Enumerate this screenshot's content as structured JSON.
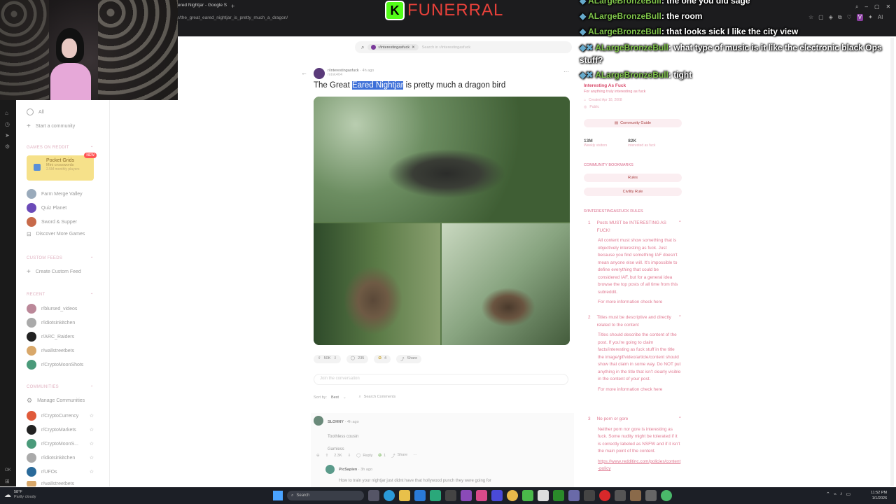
{
  "browser": {
    "tab_title": "ered Nightjar - Google S",
    "url": "r/the_great_eared_nightjar_is_pretty_much_a_dragon/"
  },
  "overlay": {
    "logo_letter": "K",
    "logo_text": "FUNERRAL",
    "chat": [
      {
        "user": "ALargeBronzeBull",
        "text": ": the one you did sage"
      },
      {
        "user": "ALargeBronzeBull",
        "text": ": the room"
      },
      {
        "user": "ALargeBronzeBull",
        "text": ": that looks sick I like the city view"
      },
      {
        "user": "ALargeBronzeBull",
        "text": ": what type of music is it like the electronic black Ops"
      },
      {
        "user": "",
        "text": "stuff?"
      },
      {
        "user": "ALargeBronzeBull",
        "text": ": tight"
      }
    ]
  },
  "search": {
    "chip": "r/interestingasfuck",
    "placeholder": "Search in r/interestingasfuck"
  },
  "sidebar": {
    "all": "All",
    "start_community": "Start a community",
    "games_header": "GAMES ON REDDIT",
    "pocket_grids": {
      "title": "Pocket Grids",
      "sub": "Mini crosswords",
      "players": "2.5M monthly players",
      "badge": "NEW"
    },
    "games": [
      "Farm Merge Valley",
      "Quiz Planet",
      "Sword & Supper",
      "Discover More Games"
    ],
    "custom_header": "CUSTOM FEEDS",
    "create_feed": "Create Custom Feed",
    "recent_header": "RECENT",
    "recent": [
      "r/blursed_videos",
      "r/idiotsinkitchen",
      "r/ARC_Raiders",
      "r/wallstreetbets",
      "r/CryptoMoonShots"
    ],
    "communities_header": "COMMUNITIES",
    "manage": "Manage Communities",
    "communities": [
      "r/CryptoCurrency",
      "r/CryptoMarkets",
      "r/CryptoMoonS...",
      "r/idiotsinkitchen",
      "r/UFOs",
      "r/wallstreetbets"
    ]
  },
  "post": {
    "subreddit": "r/interestingasfuck",
    "age": "4h ago",
    "author": "mtnk404",
    "title_before": "The Great ",
    "title_highlight": "Eared Nightjar",
    "title_after": " is pretty much a dragon bird",
    "votes": "50K",
    "comments": "235",
    "awards": "4",
    "share": "Share",
    "join": "Join the conversation",
    "sort_label": "Sort by:",
    "sort_value": "Best",
    "search_comments": "Search Comments"
  },
  "comments": [
    {
      "user": "SLOHNY",
      "age": "4h ago",
      "lines": [
        "Toothless cousin",
        "Gamless"
      ],
      "votes": "2.3K",
      "reply": "Reply",
      "award": "1",
      "share": "Share"
    },
    {
      "user": "PicSapien",
      "age": "3h ago",
      "lines": [
        "How to train your nightjar just didnt have that hollywood punch they were going for"
      ]
    }
  ],
  "right": {
    "name": "Interesting As Fuck",
    "desc": "For anything truly interesting as fuck",
    "created": "Created Apr 18, 2008",
    "public": "Public",
    "guide": "Community Guide",
    "members": "13M",
    "members_label": "Weekly visitors",
    "online": "82K",
    "online_label": "interested as fuck",
    "bookmarks_header": "COMMUNITY BOOKMARKS",
    "bookmarks": [
      "Rules",
      "Civility Rule"
    ],
    "rules_header": "R/INTERESTINGASFUCK RULES",
    "rules": [
      {
        "n": "1",
        "title": "Posts MUST be INTERESTING AS FUCK!",
        "body": "All content must show something that is objectively interesting as fuck. Just because you find something IAF doesn't mean anyone else will. It's impossible to define everything that could be considered IAF, but for a general idea browse the top posts of all time from this subreddit.",
        "more": "For more information check here"
      },
      {
        "n": "2",
        "title": "Titles must be descriptive and directly related to the content",
        "body": "Titles should describe the content of the post. If you're going to claim facts/interesting as fuck stuff in the title the image/gif/video/article/content should show that claim in some way. Do NOT put anything in the title that isn't clearly visible in the content of your post.",
        "more": "For more information check here"
      },
      {
        "n": "3",
        "title": "No porn or gore",
        "body": "Neither porn nor gore is interesting as fuck. Some nudity might be tolerated if it is correctly labeled as NSFW and if it isn't the main point of the content.",
        "link": "https://www.redditinc.com/policies/content-policy"
      }
    ]
  },
  "taskbar": {
    "temp": "58°F",
    "weather": "Partly cloudy",
    "search": "Search",
    "time": "11:52 PM",
    "date": "1/1/2026"
  }
}
